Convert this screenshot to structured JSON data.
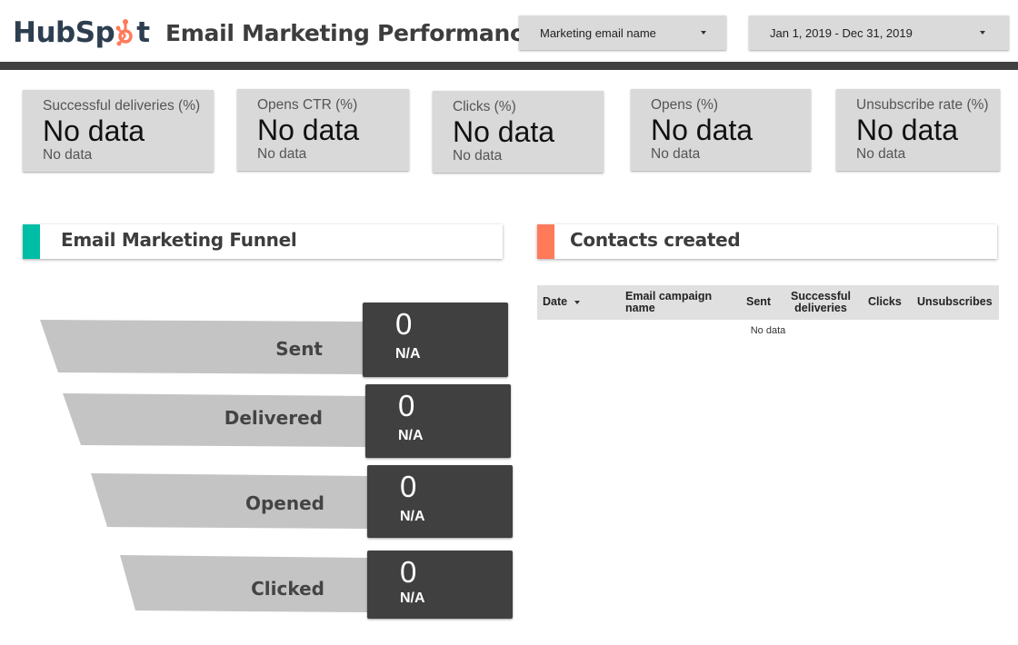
{
  "header": {
    "logo_text_left": "HubSp",
    "logo_text_right": "t",
    "title": "Email Marketing Performance",
    "filters": [
      {
        "label": "Marketing email name",
        "icon": "caret-down-icon"
      },
      {
        "label": "Jan 1, 2019 - Dec 31, 2019",
        "icon": "caret-down-icon"
      }
    ]
  },
  "colors": {
    "brand_orange": "#ff7a59",
    "brand_navy": "#2d3e50",
    "funnel_accent": "#00bda5",
    "contacts_accent": "#ff7a59",
    "dark_bar": "#404040",
    "card_bg": "#d9d9d9"
  },
  "kpis": [
    {
      "label": "Successful deliveries (%)",
      "value": "No data",
      "sub": "No data"
    },
    {
      "label": "Opens CTR (%)",
      "value": "No data",
      "sub": "No data"
    },
    {
      "label": "Clicks (%)",
      "value": "No data",
      "sub": "No data"
    },
    {
      "label": "Opens (%)",
      "value": "No data",
      "sub": "No data"
    },
    {
      "label": "Unsubscribe rate (%)",
      "value": "No data",
      "sub": "No data"
    }
  ],
  "funnel": {
    "title": "Email Marketing Funnel",
    "stages": [
      {
        "label": "Sent",
        "value": "0",
        "sub": "N/A"
      },
      {
        "label": "Delivered",
        "value": "0",
        "sub": "N/A"
      },
      {
        "label": "Opened",
        "value": "0",
        "sub": "N/A"
      },
      {
        "label": "Clicked",
        "value": "0",
        "sub": "N/A"
      }
    ]
  },
  "contacts": {
    "title": "Contacts created",
    "columns": [
      {
        "label": "Date",
        "sort_icon": "caret-down-icon"
      },
      {
        "label": "Email campaign name"
      },
      {
        "label": "Sent"
      },
      {
        "label": "Successful deliveries"
      },
      {
        "label": "Clicks"
      },
      {
        "label": "Unsubscribes"
      }
    ],
    "empty_text": "No data"
  }
}
